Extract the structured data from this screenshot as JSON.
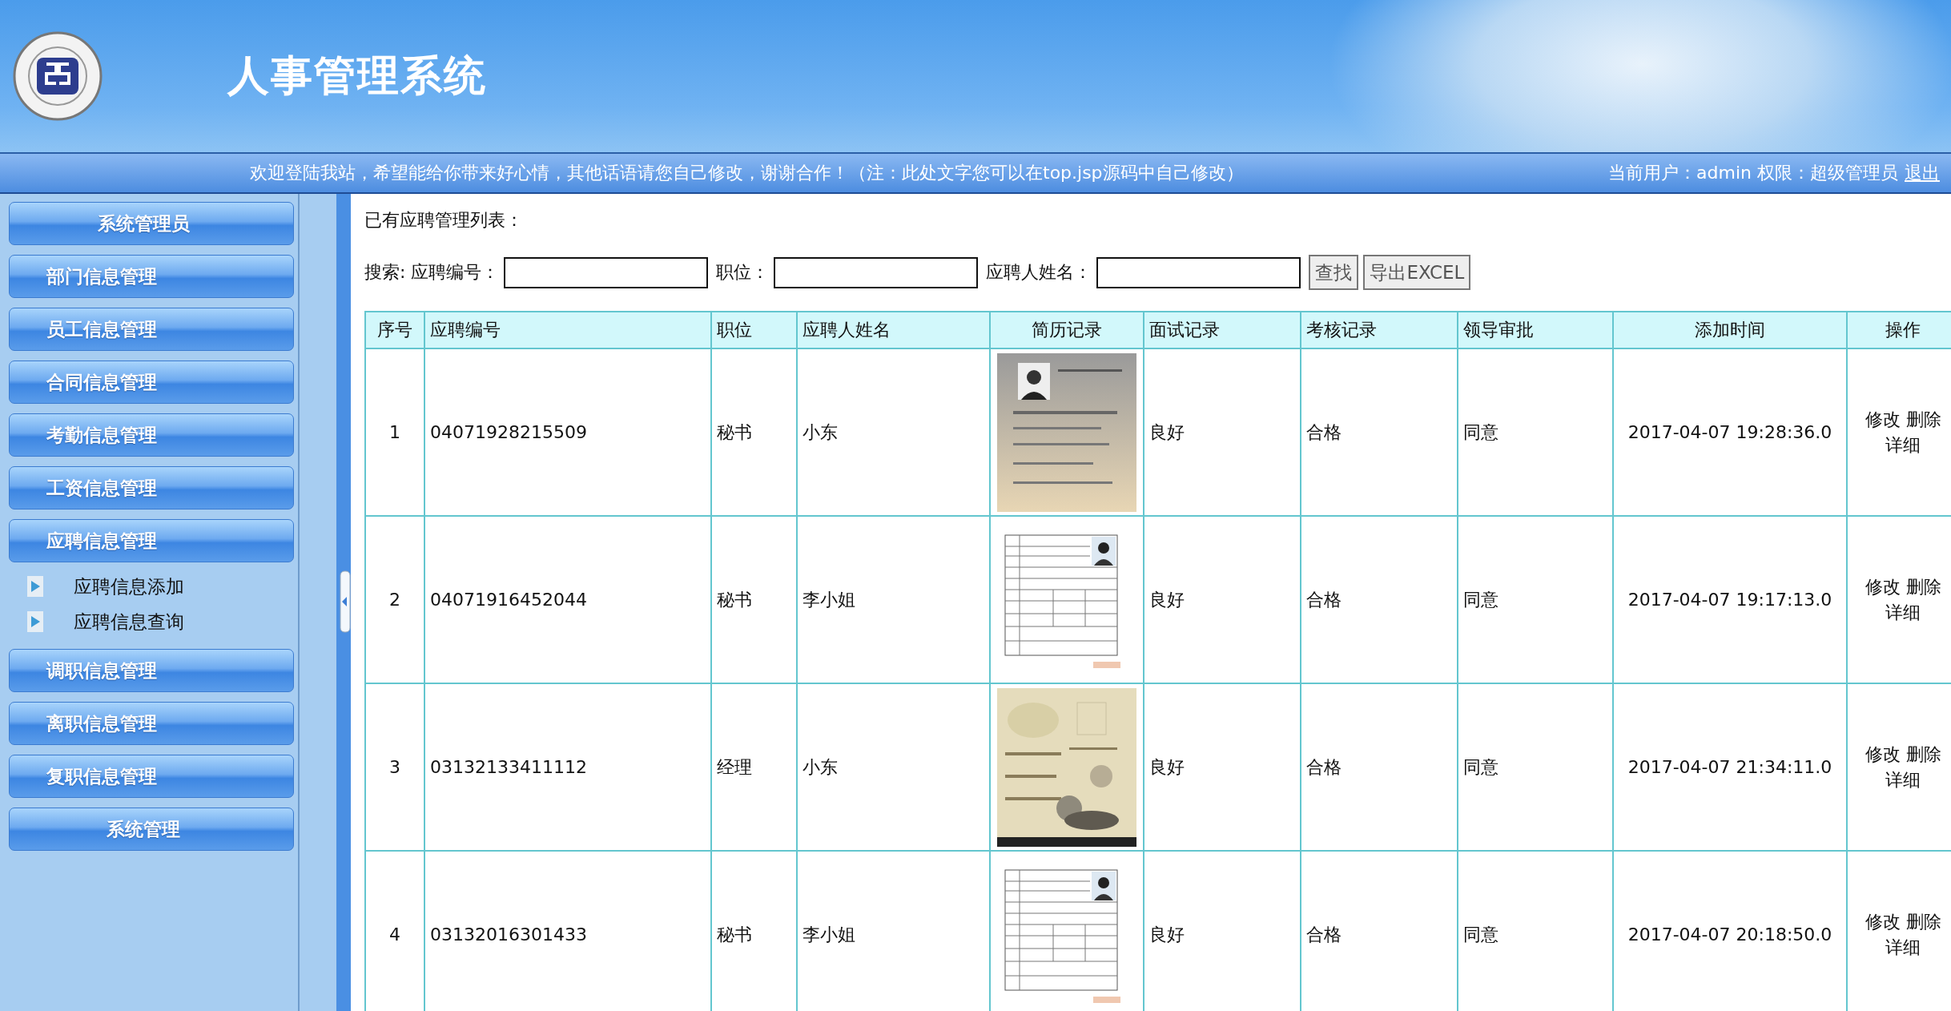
{
  "header": {
    "title": "人事管理系统"
  },
  "welcome_bar": {
    "message": "欢迎登陆我站，希望能给你带来好心情，其他话语请您自己修改，谢谢合作！（注：此处文字您可以在top.jsp源码中自己修改）",
    "user_info": "当前用户：admin 权限：超级管理员",
    "logout_link": "退出"
  },
  "sidebar": {
    "items": [
      {
        "label": "系统管理员",
        "kind": "centered"
      },
      {
        "label": "部门信息管理",
        "kind": "group"
      },
      {
        "label": "员工信息管理",
        "kind": "group"
      },
      {
        "label": "合同信息管理",
        "kind": "group"
      },
      {
        "label": "考勤信息管理",
        "kind": "group"
      },
      {
        "label": "工资信息管理",
        "kind": "group"
      },
      {
        "label": "应聘信息管理",
        "kind": "group",
        "children": [
          {
            "label": "应聘信息添加"
          },
          {
            "label": "应聘信息查询"
          }
        ]
      },
      {
        "label": "调职信息管理",
        "kind": "group"
      },
      {
        "label": "离职信息管理",
        "kind": "group"
      },
      {
        "label": "复职信息管理",
        "kind": "group"
      },
      {
        "label": "系统管理",
        "kind": "centered"
      }
    ]
  },
  "main": {
    "heading": "已有应聘管理列表：",
    "search": {
      "fields": [
        {
          "label": "搜索: 应聘编号："
        },
        {
          "label": "职位："
        },
        {
          "label": "应聘人姓名："
        }
      ],
      "buttons": [
        "查找",
        "导出EXCEL"
      ]
    },
    "table": {
      "columns": [
        "序号",
        "应聘编号",
        "职位",
        "应聘人姓名",
        "简历记录",
        "面试记录",
        "考核记录",
        "领导审批",
        "添加时间",
        "操作"
      ],
      "rows": [
        {
          "no": "1",
          "code": "04071928215509",
          "position": "秘书",
          "name": "小东",
          "resume": {
            "kind": "picture"
          },
          "interview": "良好",
          "assessment": "合格",
          "approval": "同意",
          "added": "2017-04-07 19:28:36.0",
          "actions": [
            "修改",
            "删除",
            "详细"
          ]
        },
        {
          "no": "2",
          "code": "04071916452044",
          "position": "秘书",
          "name": "李小姐",
          "resume": {
            "kind": "picture"
          },
          "interview": "良好",
          "assessment": "合格",
          "approval": "同意",
          "added": "2017-04-07 19:17:13.0",
          "actions": [
            "修改",
            "删除",
            "详细"
          ]
        },
        {
          "no": "3",
          "code": "03132133411112",
          "position": "经理",
          "name": "小东",
          "resume": {
            "kind": "picture"
          },
          "interview": "良好",
          "assessment": "合格",
          "approval": "同意",
          "added": "2017-04-07 21:34:11.0",
          "actions": [
            "修改",
            "删除",
            "详细"
          ]
        },
        {
          "no": "4",
          "code": "03132016301433",
          "position": "秘书",
          "name": "李小姐",
          "resume": {
            "kind": "picture"
          },
          "interview": "良好",
          "assessment": "合格",
          "approval": "同意",
          "added": "2017-04-07 20:18:50.0",
          "actions": [
            "修改",
            "删除",
            "详细"
          ]
        }
      ]
    }
  }
}
